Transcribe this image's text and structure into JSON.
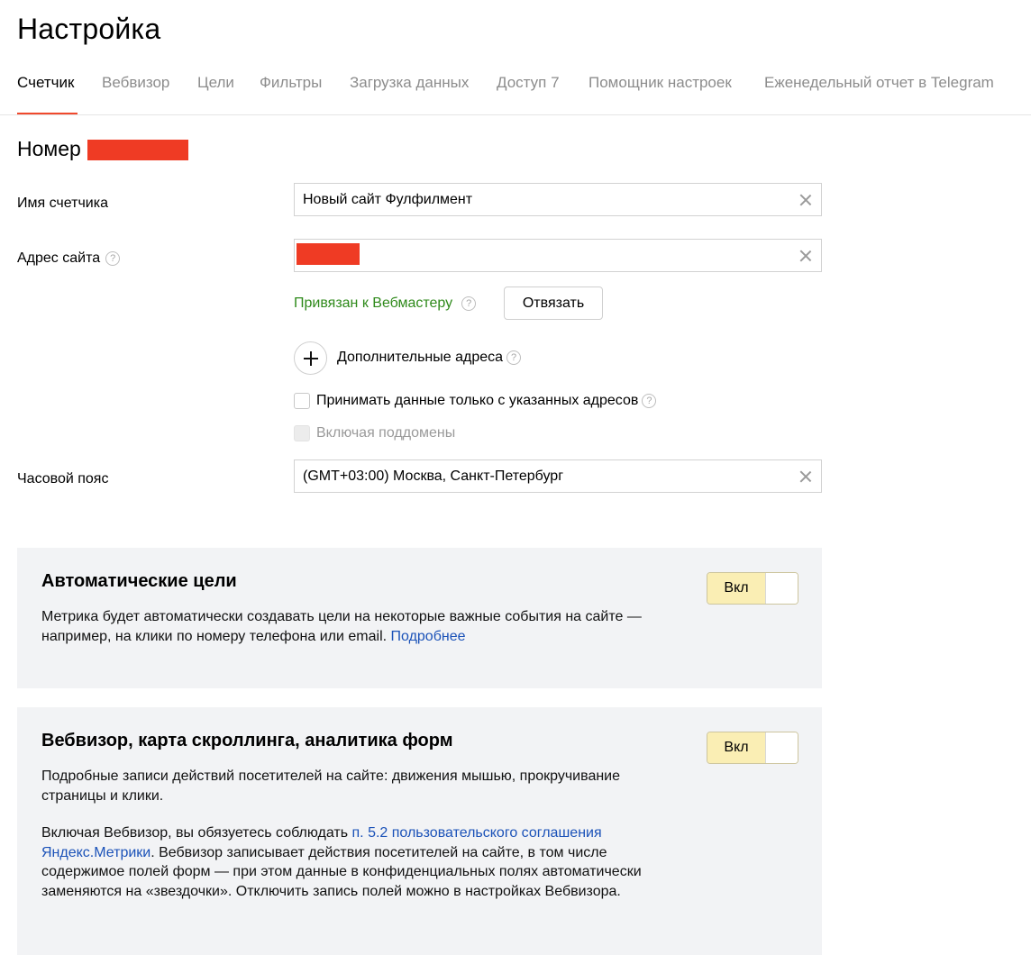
{
  "page": {
    "title": "Настройка"
  },
  "tabs": [
    {
      "label": "Счетчик",
      "active": true
    },
    {
      "label": "Вебвизор",
      "active": false
    },
    {
      "label": "Цели",
      "active": false
    },
    {
      "label": "Фильтры",
      "active": false
    },
    {
      "label": "Загрузка данных",
      "active": false
    },
    {
      "label": "Доступ 7",
      "active": false
    },
    {
      "label": "Помощник настроек",
      "active": false
    },
    {
      "label": "Еженедельный отчет в Telegram",
      "active": false
    }
  ],
  "counter": {
    "number_label": "Номер",
    "name": {
      "label": "Имя счетчика",
      "value": "Новый сайт Фулфилмент"
    },
    "site": {
      "label": "Адрес сайта",
      "bound_text": "Привязан к Вебмастеру",
      "unbind_label": "Отвязать",
      "extra_addresses_label": "Дополнительные адреса",
      "only_listed_label": "Принимать данные только с указанных адресов",
      "subdomains_label": "Включая поддомены"
    },
    "timezone": {
      "label": "Часовой пояс",
      "value": "(GMT+03:00) Москва, Санкт-Петербург"
    }
  },
  "auto_goals": {
    "title": "Автоматические цели",
    "text": "Метрика будет автоматически создавать цели на некоторые важные события на сайте — например, на клики по номеру телефона или email. ",
    "link": "Подробнее",
    "toggle_label": "Вкл"
  },
  "webvisor": {
    "title": "Вебвизор, карта скроллинга, аналитика форм",
    "text1": "Подробные записи действий посетителей на сайте: движения мышью, прокручивание страницы и клики.",
    "text2_prefix": "Включая Вебвизор, вы обязуетесь соблюдать ",
    "text2_link": "п. 5.2 пользовательского соглашения Яндекс.Метрики",
    "text2_suffix": ". Вебвизор записывает действия посетителей на сайте, в том числе содержимое полей форм — при этом данные в конфиденциальных полях автоматически заменяются на «звездочки». Отключить запись полей можно в настройках Вебвизора.",
    "toggle_label": "Вкл"
  },
  "colors": {
    "accent": "#f0492d",
    "bound_green": "#2f8a1b",
    "link_blue": "#1b52b8",
    "toggle_on": "#faeeb4",
    "card_bg": "#f2f3f5"
  },
  "icons": {
    "help": "question-circle-icon",
    "clear": "close-icon",
    "add": "plus-icon"
  }
}
